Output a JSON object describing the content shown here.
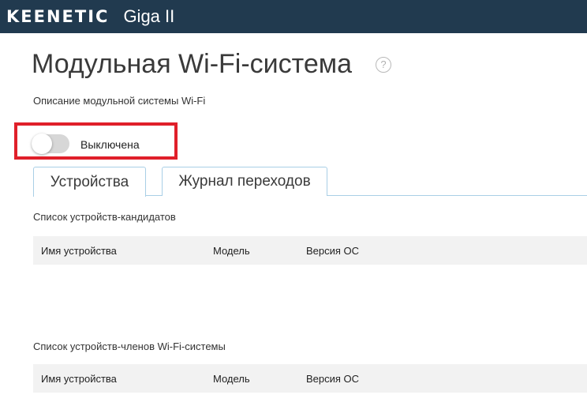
{
  "header": {
    "brand": "KEENETIC",
    "model": "Giga II",
    "background": "#213a4f"
  },
  "page": {
    "title": "Модульная Wi-Fi-система",
    "help_icon": "question-circle-icon",
    "description": "Описание модульной системы Wi-Fi"
  },
  "toggle": {
    "label": "Выключена",
    "state": "off",
    "highlight_color": "#e0202a"
  },
  "tabs": [
    {
      "label": "Устройства",
      "active": true
    },
    {
      "label": "Журнал переходов",
      "active": false
    }
  ],
  "candidates": {
    "title": "Список устройств-кандидатов",
    "columns": [
      "Имя устройства",
      "Модель",
      "Версия ОС"
    ],
    "rows": []
  },
  "members": {
    "title": "Список устройств-членов Wi-Fi-системы",
    "columns": [
      "Имя устройства",
      "Модель",
      "Версия ОС"
    ],
    "rows": []
  }
}
